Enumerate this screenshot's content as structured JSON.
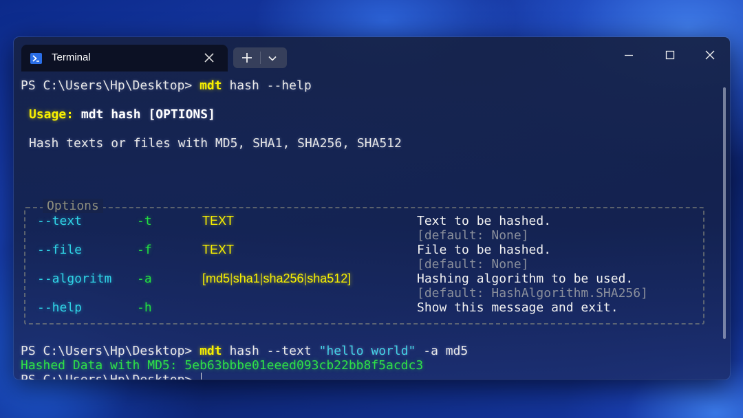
{
  "window": {
    "tab_title": "Terminal",
    "controls": [
      "minimize-icon",
      "maximize-icon",
      "close-icon"
    ]
  },
  "terminal": {
    "cmd1": {
      "prompt": "PS C:\\Users\\Hp\\Desktop>",
      "exe": "mdt",
      "args": "hash --help"
    },
    "usage": {
      "label": "Usage:",
      "text": "mdt hash [OPTIONS]"
    },
    "description": "Hash texts or files with MD5, SHA1, SHA256, SHA512",
    "options_title": "Options",
    "options": [
      {
        "long": "--text",
        "short": "-t",
        "type": "TEXT",
        "desc": "Text to be hashed.",
        "default": "[default: None]"
      },
      {
        "long": "--file",
        "short": "-f",
        "type": "TEXT",
        "desc": "File to be hashed.",
        "default": "[default: None]"
      },
      {
        "long": "--algoritm",
        "short": "-a",
        "type_open": "[",
        "choices": [
          "md5",
          "sha1",
          "sha256",
          "sha512"
        ],
        "type_close": "]",
        "desc": "Hashing algorithm to be used.",
        "default": "[default: HashAlgorithm.SHA256]"
      },
      {
        "long": "--help",
        "short": "-h",
        "type": "",
        "desc": "Show this message and exit.",
        "default": ""
      }
    ],
    "cmd2": {
      "prompt": "PS C:\\Users\\Hp\\Desktop>",
      "exe": "mdt",
      "args_a": "hash --text",
      "quoted": "\"hello world\"",
      "args_b": "-a md5"
    },
    "result": "Hashed Data with MD5: 5eb63bbbe01eeed093cb22bb8f5acdc3",
    "prompt3": "PS C:\\Users\\Hp\\Desktop>"
  }
}
